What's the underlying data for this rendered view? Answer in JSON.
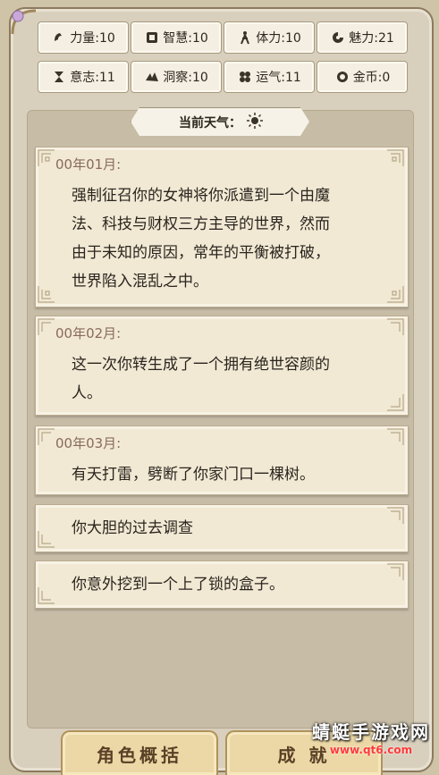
{
  "stats": [
    {
      "label": "力量:10",
      "icon": "strength-icon"
    },
    {
      "label": "智慧:10",
      "icon": "wisdom-icon"
    },
    {
      "label": "体力:10",
      "icon": "stamina-icon"
    },
    {
      "label": "魅力:21",
      "icon": "charm-icon"
    },
    {
      "label": "意志:11",
      "icon": "will-icon"
    },
    {
      "label": "洞察:10",
      "icon": "insight-icon"
    },
    {
      "label": "运气:11",
      "icon": "luck-icon"
    },
    {
      "label": "金币:0",
      "icon": "coin-icon"
    }
  ],
  "weather": {
    "label": "当前天气：",
    "icon": "sun-icon"
  },
  "events": [
    {
      "month": "00年01月:",
      "lines": [
        "强制征召你的女神将你派遣到一个由魔",
        "法、科技与财权三方主导的世界，然而",
        "由于未知的原因，常年的平衡被打破，",
        "世界陷入混乱之中。"
      ]
    },
    {
      "month": "00年02月:",
      "lines": [
        "这一次你转生成了一个拥有绝世容颜的",
        "人。"
      ]
    },
    {
      "month": "00年03月:",
      "lines": [
        "有天打雷，劈断了你家门口一棵树。"
      ]
    },
    {
      "month": "",
      "lines": [
        "你大胆的过去调查"
      ]
    },
    {
      "month": "",
      "lines": [
        "你意外挖到一个上了锁的盒子。"
      ]
    }
  ],
  "buttons": {
    "profile": "角色概括",
    "achievements": "成 就"
  },
  "watermark": {
    "title": "蜻蜓手游戏网",
    "url": "www.qt6.com"
  }
}
